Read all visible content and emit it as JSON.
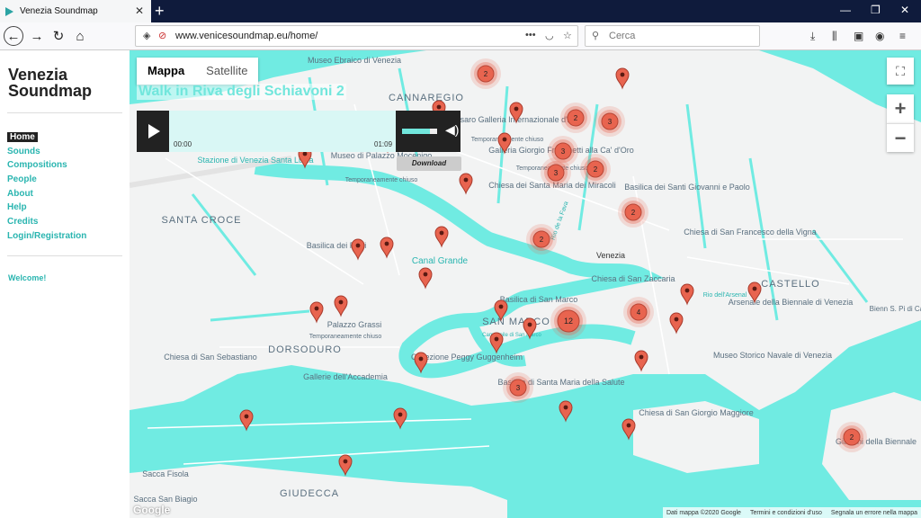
{
  "browser": {
    "tab_title": "Venezia Soundmap",
    "url": "www.venicesoundmap.eu/home/",
    "search_placeholder": "Cerca"
  },
  "sidebar": {
    "brand": "Venezia Soundmap",
    "menu": [
      "Home",
      "Sounds",
      "Compositions",
      "People",
      "About",
      "Help",
      "Credits",
      "Login/Registration"
    ],
    "active": "Home",
    "welcome": "Welcome!"
  },
  "map": {
    "tabs": [
      "Mappa",
      "Satellite"
    ],
    "selected_tab": "Mappa",
    "walk_title": "Walk in Riva degli Schiavoni 2",
    "player": {
      "current_time": "00:00",
      "duration": "01:09",
      "download_label": "Download"
    },
    "zoom_in": "+",
    "zoom_out": "−",
    "attribution": [
      "Dati mappa ©2020 Google",
      "Termini e condizioni d'uso",
      "Segnala un errore nella mappa"
    ],
    "google_logo": "Google",
    "place_labels": [
      "Museo Ebraico di Venezia",
      "CANNAREGIO",
      "Pesaro Galleria Internazionale d'Arte",
      "Temporaneamente chiuso",
      "Galleria Giorgio Franchetti alla Ca' d'Oro",
      "Temporaneamente chiuso",
      "Stazione di Venezia Santa Lucia",
      "Museo di Palazzo Mocenigo",
      "Temporaneamente chiuso",
      "Chiesa dei Santa Maria dei Miracoli",
      "Basilica dei Santi Giovanni e Paolo",
      "SANTA CROCE",
      "Basilica dei Frari",
      "Canal Grande",
      "Venezia",
      "Chiesa di San Francesco della Vigna",
      "CASTELLO",
      "Chiesa di San Zaccaria",
      "Arsenale della Biennale di Venezia",
      "Basilica di San Marco",
      "SAN MARCO",
      "Palazzo Grassi",
      "Temporaneamente chiuso",
      "DORSODURO",
      "Collezione Peggy Guggenheim",
      "Chiesa di San Sebastiano",
      "Gallerie dell'Accademia",
      "Museo Storico Navale di Venezia",
      "Basilica di Santa Maria della Salute",
      "Chiesa di San Giorgio Maggiore",
      "Giardini della Biennale",
      "Sacca Fisola",
      "Sacca San Biagio",
      "GIUDECCA",
      "Rio dell'Arsenal",
      "Rio de la Fava",
      "Campanile di San Marco",
      "Bienn S. Pi di Castell"
    ],
    "clusters": [
      2,
      2,
      3,
      3,
      2,
      3,
      2,
      2,
      2,
      4,
      12,
      3,
      2
    ],
    "pin_count": 26
  },
  "colors": {
    "water": "#70ebe2",
    "cluster": "#e8644f",
    "pin": "#e8644f",
    "accent": "#2ab5b0",
    "tabstrip": "#0f1b3c"
  }
}
